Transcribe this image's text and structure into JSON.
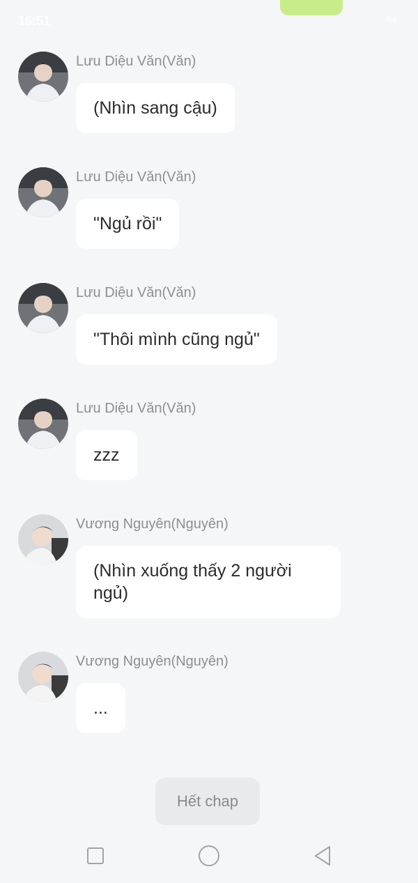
{
  "status_bar": {
    "time": "16:51",
    "right_info": "64"
  },
  "messages": [
    {
      "sender": "Lưu Diệu Văn(Văn)",
      "text": "(Nhìn sang cậu)"
    },
    {
      "sender": "Lưu Diệu Văn(Văn)",
      "text": "\"Ngủ rồi\""
    },
    {
      "sender": "Lưu Diệu Văn(Văn)",
      "text": "\"Thôi mình cũng ngủ\""
    },
    {
      "sender": "Lưu Diệu Văn(Văn)",
      "text": "zzz"
    },
    {
      "sender": "Vương Nguyên(Nguyên)",
      "text": "(Nhìn xuống thấy 2 người ngủ)"
    },
    {
      "sender": "Vương Nguyên(Nguyên)",
      "text": "..."
    }
  ],
  "end_button": {
    "label": "Hết chap"
  },
  "nav_bar": {
    "icons": [
      "square-icon",
      "circle-icon",
      "back-triangle-icon"
    ]
  },
  "colors": {
    "background": "#f5f6f8",
    "bubble": "#ffffff",
    "sender": "#8e8e93",
    "accent_pill": "#c9ec8a"
  }
}
